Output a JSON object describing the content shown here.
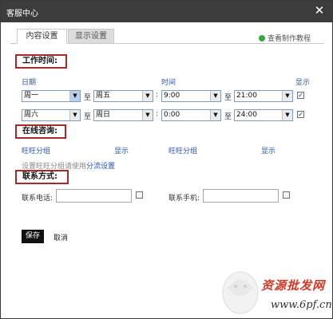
{
  "window": {
    "title": "客服中心",
    "close_icon": "close-icon"
  },
  "tabs": [
    {
      "label": "内容设置",
      "active": true
    },
    {
      "label": "显示设置",
      "active": false
    }
  ],
  "tutorial": {
    "label": "查看制作教程",
    "icon": "green-dot-icon"
  },
  "work_time": {
    "title": "工作时间:",
    "col_date": "日期",
    "col_time": "时间",
    "col_show": "显示",
    "to": "至",
    "colon": ":",
    "rows": [
      {
        "day_from": "周一",
        "day_to": "周五",
        "time_from": "9:00",
        "time_to": "21:00",
        "show": true
      },
      {
        "day_from": "周六",
        "day_to": "周日",
        "time_from": "0:00",
        "time_to": "24:00",
        "show": true
      }
    ]
  },
  "online": {
    "title": "在线咨询:",
    "col_group_1": "旺旺分组",
    "col_show_1": "显示",
    "col_group_2": "旺旺分组",
    "col_show_2": "显示",
    "hint_prefix": "设置旺旺分组请使用",
    "hint_link": "分流设置"
  },
  "contact": {
    "title": "联系方式:",
    "phone_label": "联系电话:",
    "phone_value": "",
    "mobile_label": "联系手机:",
    "mobile_value": ""
  },
  "actions": {
    "save": "保存",
    "cancel": "取消"
  },
  "watermark": {
    "text": "资源批发网",
    "url": "www.6pf.cn"
  },
  "colors": {
    "titlebar": "#3c3c3c",
    "section_border": "#a52a2a",
    "link_blue": "#2855a8",
    "save_button": "#111111"
  }
}
